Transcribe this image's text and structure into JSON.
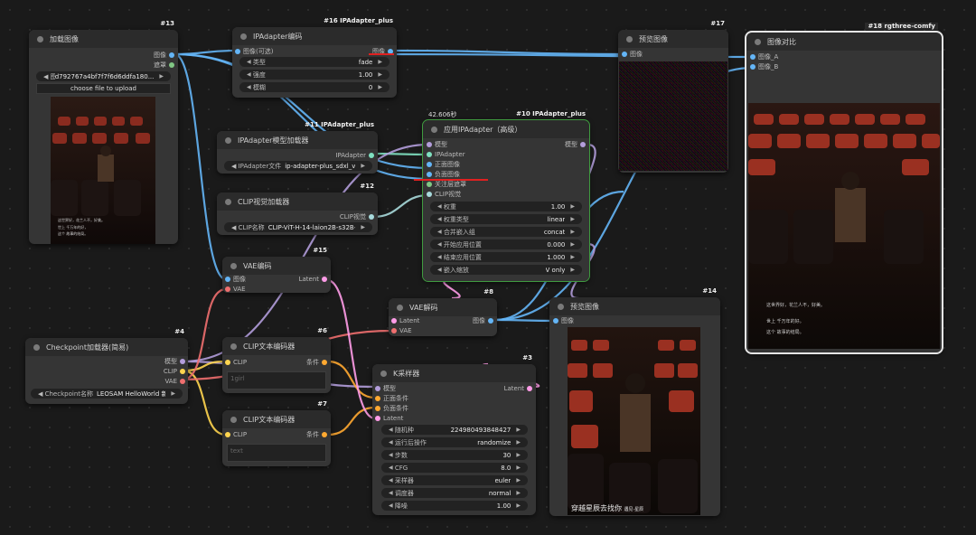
{
  "nodes": {
    "load_image": {
      "id": "#13",
      "title": "加载图像",
      "outputs": [
        "图像",
        "遮罩"
      ],
      "widget": {
        "label": "◀ 图像",
        "value": "d792767a4bf7f7f6d6ddfa180..."
      },
      "upload_label": "choose file to upload",
      "caption_lines": [
        "这世界好，花兰人不，好美。",
        "世上 千万年的好，",
        "这个 故事的结局。"
      ]
    },
    "ipadapter_tiled": {
      "id": "#16 IPAdapter_plus",
      "title": "IPAdapter编码",
      "inputs": [
        "图像(可选)"
      ],
      "outputs": [
        "图像"
      ],
      "widgets": [
        {
          "label": "类型",
          "value": "fade"
        },
        {
          "label": "强度",
          "value": "1.00"
        },
        {
          "label": "模糊",
          "value": "0"
        }
      ]
    },
    "preview17": {
      "id": "#17",
      "title": "预览图像",
      "inputs": [
        "图像"
      ]
    },
    "compare": {
      "id": "#18 rgthree-comfy",
      "title": "图像对比",
      "inputs": [
        "图像_A",
        "图像_B"
      ],
      "caption_lines": [
        "这世界好，花兰人不，好美。",
        "世上 千万年的好。",
        "这个 故事的结局。"
      ]
    },
    "ipa_loader": {
      "id": "#11 IPAdapter_plus",
      "title": "IPAdapter模型加载器",
      "outputs": [
        "IPAdapter"
      ],
      "widget": {
        "label": "◀ IPAdapter文件",
        "value": "ip-adapter-plus_sdxl_vit-h"
      }
    },
    "clip_vision": {
      "id": "#12",
      "title": "CLIP视觉加载器",
      "outputs": [
        "CLIP视觉"
      ],
      "widget": {
        "label": "◀ CLIP名称",
        "value": "CLIP-ViT-H-14-laion2B-s32B-..."
      }
    },
    "apply_ipa": {
      "id": "#10 IPAdapter_plus",
      "title": "应用IPAdapter（高级）",
      "exec_time": "42.606秒",
      "inputs": [
        "模型",
        "IPAdapter",
        "正面图像",
        "负面图像",
        "关注层遮罩",
        "CLIP视觉"
      ],
      "outputs": [
        "模型"
      ],
      "widgets": [
        {
          "label": "权重",
          "value": "1.00"
        },
        {
          "label": "权重类型",
          "value": "linear"
        },
        {
          "label": "合并嵌入组",
          "value": "concat"
        },
        {
          "label": "开始应用位置",
          "value": "0.000"
        },
        {
          "label": "结束应用位置",
          "value": "1.000"
        },
        {
          "label": "嵌入缩放",
          "value": "V only"
        }
      ]
    },
    "vae_encode": {
      "id": "#15",
      "title": "VAE编码",
      "inputs": [
        "图像",
        "VAE"
      ],
      "outputs": [
        "Latent"
      ]
    },
    "vae_decode": {
      "id": "#8",
      "title": "VAE解码",
      "inputs": [
        "Latent",
        "VAE"
      ],
      "outputs": [
        "图像"
      ]
    },
    "preview14": {
      "id": "#14",
      "title": "预览图像",
      "inputs": [
        "图像"
      ],
      "caption": "穿越星辰去找你",
      "caption_small": "遇见·星辰"
    },
    "checkpoint": {
      "id": "#4",
      "title": "Checkpoint加载器(简易)",
      "outputs": [
        "模型",
        "CLIP",
        "VAE"
      ],
      "widget": {
        "label": "◀ Checkpoint名称",
        "value": "LEOSAM HelloWorld 新..."
      }
    },
    "clip_text6": {
      "id": "#6",
      "title": "CLIP文本编码器",
      "inputs": [
        "CLIP"
      ],
      "outputs": [
        "条件"
      ],
      "text": "1girl"
    },
    "clip_text7": {
      "id": "#7",
      "title": "CLIP文本编码器",
      "inputs": [
        "CLIP"
      ],
      "outputs": [
        "条件"
      ],
      "text": "text"
    },
    "ksampler": {
      "id": "#3",
      "title": "K采样器",
      "inputs": [
        "模型",
        "正面条件",
        "负面条件",
        "Latent"
      ],
      "outputs": [
        "Latent"
      ],
      "widgets": [
        {
          "label": "随机种",
          "value": "224980493848427"
        },
        {
          "label": "运行后操作",
          "value": "randomize"
        },
        {
          "label": "步数",
          "value": "30"
        },
        {
          "label": "CFG",
          "value": "8.0"
        },
        {
          "label": "采样器",
          "value": "euler"
        },
        {
          "label": "调度器",
          "value": "normal"
        },
        {
          "label": "降噪",
          "value": "1.00"
        }
      ]
    }
  },
  "colors": {
    "image": "#64b5f6",
    "mask": "#81c784",
    "model": "#b39ddb",
    "clip": "#ffd54f",
    "vae": "#ef6f6f",
    "latent": "#ff9ce8",
    "conditioning": "#ffa931",
    "ipadapter": "#7fe0c0",
    "clipvision": "#a8dadc"
  }
}
